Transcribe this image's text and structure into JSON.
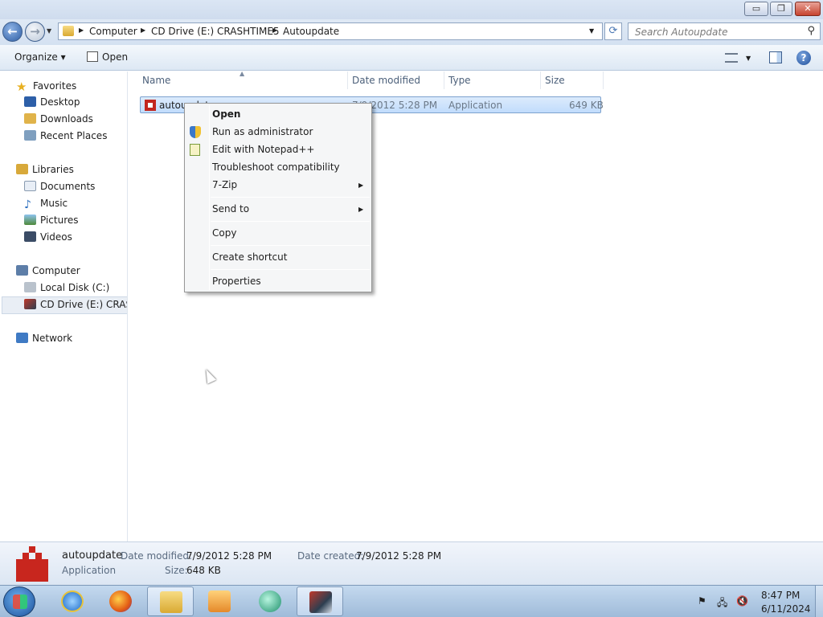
{
  "window": {
    "controls": {
      "minimize": "▭",
      "maximize": "❐",
      "close": "✕"
    }
  },
  "address": {
    "crumbs": [
      "Computer",
      "CD Drive (E:) CRASHTIME5",
      "Autoupdate"
    ],
    "search_placeholder": "Search Autoupdate"
  },
  "toolbar": {
    "organize": "Organize ▾",
    "open": "Open"
  },
  "navpane": {
    "favorites": "Favorites",
    "favorites_items": [
      "Desktop",
      "Downloads",
      "Recent Places"
    ],
    "libraries": "Libraries",
    "libraries_items": [
      "Documents",
      "Music",
      "Pictures",
      "Videos"
    ],
    "computer": "Computer",
    "computer_items": [
      "Local Disk (C:)",
      "CD Drive (E:) CRASH"
    ],
    "network": "Network"
  },
  "columns": {
    "name": "Name",
    "date": "Date modified",
    "type": "Type",
    "size": "Size"
  },
  "file": {
    "name": "autoupdate",
    "date": "7/9/2012 5:28 PM",
    "type": "Application",
    "size": "649 KB"
  },
  "context_menu": {
    "open": "Open",
    "run_admin": "Run as administrator",
    "edit_notepad": "Edit with Notepad++",
    "troubleshoot": "Troubleshoot compatibility",
    "zip": "7-Zip",
    "send_to": "Send to",
    "copy": "Copy",
    "create_shortcut": "Create shortcut",
    "properties": "Properties"
  },
  "details": {
    "name": "autoupdate",
    "type": "Application",
    "date_modified_label": "Date modified:",
    "date_modified": "7/9/2012 5:28 PM",
    "size_label": "Size:",
    "size": "648 KB",
    "date_created_label": "Date created:",
    "date_created": "7/9/2012 5:28 PM"
  },
  "taskbar": {
    "time": "8:47 PM",
    "date": "6/11/2024",
    "apps": [
      "internet-explorer",
      "firefox",
      "windows-explorer",
      "media-player",
      "app-green",
      "crashtime-game"
    ]
  }
}
